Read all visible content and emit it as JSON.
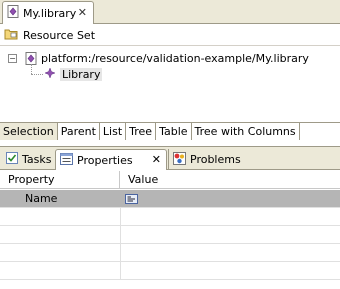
{
  "editor": {
    "tab_label": "My.library",
    "close_glyph": "✕",
    "resource_set_label": "Resource Set",
    "tree": {
      "root_label": "platform:/resource/validation-example/My.library",
      "expander_glyph": "−",
      "child_label": "Library"
    }
  },
  "page_tabs": [
    "Selection",
    "Parent",
    "List",
    "Tree",
    "Table",
    "Tree with Columns"
  ],
  "views": {
    "tasks_label": "Tasks",
    "properties_label": "Properties",
    "problems_label": "Problems",
    "close_glyph": "✕"
  },
  "properties_table": {
    "headers": [
      "Property",
      "Value"
    ],
    "rows": [
      {
        "name": "Name",
        "value": ""
      }
    ]
  },
  "icons": {
    "library_file": "library-file-icon",
    "resource_set": "resource-set-folder-icon",
    "resource": "resource-icon",
    "library_object": "library-object-icon",
    "tasks": "tasks-icon",
    "properties": "properties-icon",
    "problems": "problems-icon",
    "value_field": "text-value-icon"
  },
  "colors": {
    "chrome": "#ece9d8",
    "border": "#9e9a88",
    "selection": "#b5b5b5",
    "icon_purple": "#8040a0"
  }
}
